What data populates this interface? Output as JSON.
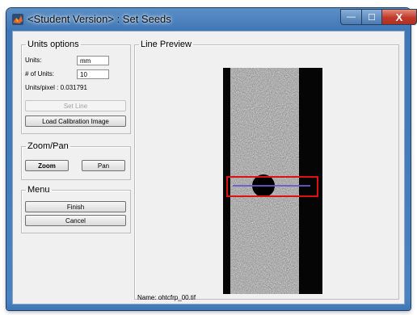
{
  "window": {
    "title": "<Student Version> : Set Seeds",
    "minimize_glyph": "—",
    "maximize_glyph": "☐",
    "close_glyph": "X"
  },
  "units_panel": {
    "legend": "Units options",
    "units_label": "Units:",
    "units_value": "mm",
    "num_units_label": "# of Units:",
    "num_units_value": "10",
    "units_per_pixel": "Units/pixel : 0.031791",
    "set_line_label": "Set Line",
    "load_calibration_label": "Load Calibration Image"
  },
  "zoom_panel": {
    "legend": "Zoom/Pan",
    "zoom_label": "Zoom",
    "pan_label": "Pan"
  },
  "menu_panel": {
    "legend": "Menu",
    "finish_label": "Finish",
    "cancel_label": "Cancel"
  },
  "preview_panel": {
    "legend": "Line Preview",
    "name_label": "Name: ohtcfrp_00.tif"
  },
  "colors": {
    "selection_rect": "#e01010",
    "seed_line": "#6a5acd",
    "titlebar": "#3f77b6",
    "close_button": "#c0392b"
  }
}
